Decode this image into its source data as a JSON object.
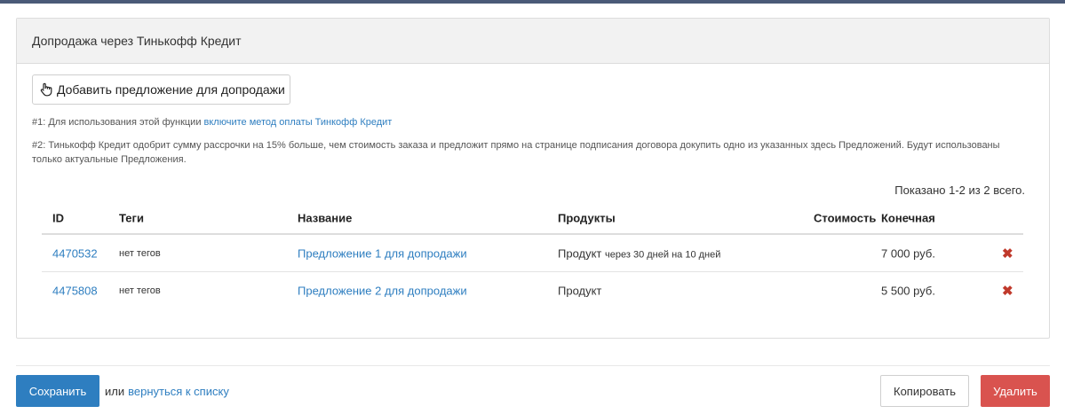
{
  "panel": {
    "title": "Допродажа через Тинькофф Кредит",
    "add_button": {
      "label": "Добавить предложение для допродажи",
      "icon": "hand-pointer-icon"
    },
    "note1_prefix": "#1: Для использования этой функции ",
    "note1_link": "включите метод оплаты Тинкофф Кредит",
    "note2": "#2: Тинькофф Кредит одобрит сумму рассрочки на 15% больше, чем стоимость заказа и предложит прямо на странице подписания договора докупить одно из указанных здесь Предложений. Будут использованы только актуальные Предложения.",
    "shown": "Показано 1-2 из 2 всего."
  },
  "table": {
    "headers": {
      "id": "ID",
      "tags": "Теги",
      "name": "Название",
      "products": "Продукты",
      "cost": "Стоимость",
      "final": "Конечная"
    },
    "rows": [
      {
        "id": "4470532",
        "tags": "нет тегов",
        "name": "Предложение 1 для допродажи",
        "product": "Продукт",
        "product_detail": "через 30 дней на 10 дней",
        "cost": "",
        "final": "7 000 руб.",
        "delete_icon": "x-delete-icon"
      },
      {
        "id": "4475808",
        "tags": "нет тегов",
        "name": "Предложение 2 для допродажи",
        "product": "Продукт",
        "product_detail": "",
        "cost": "",
        "final": "5 500 руб.",
        "delete_icon": "x-delete-icon"
      }
    ]
  },
  "footer": {
    "save": "Сохранить",
    "or": "или",
    "back_link": "вернуться к списку",
    "copy": "Копировать",
    "delete": "Удалить"
  },
  "colors": {
    "primary": "#2e7ec0",
    "danger": "#d9534f",
    "delete_x": "#c0392b",
    "header_bg": "#f2f2f2"
  }
}
